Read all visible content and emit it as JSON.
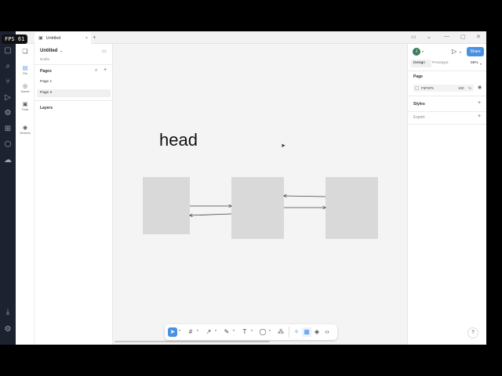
{
  "overlay": {
    "fps": "FPS 61"
  },
  "browser": {
    "tab_title": "Untitled",
    "tab_close": "×",
    "new_tab": "+"
  },
  "rail": {
    "items": [
      {
        "label": "File",
        "icon": "file-icon"
      },
      {
        "label": "Assets",
        "icon": "assets-icon"
      },
      {
        "label": "Tools",
        "icon": "tools-icon"
      },
      {
        "label": "Versions",
        "icon": "versions-icon"
      }
    ]
  },
  "left_panel": {
    "file_name": "Untitled",
    "location": "Drafts",
    "pages_heading": "Pages",
    "pages": [
      {
        "label": "Page 1",
        "active": false
      },
      {
        "label": "Page 2",
        "active": true
      }
    ],
    "layers_heading": "Layers"
  },
  "canvas": {
    "text_layer": "head"
  },
  "right_panel": {
    "avatar_initial": "J",
    "share_label": "Share",
    "tabs": [
      {
        "label": "Design",
        "active": true
      },
      {
        "label": "Prototype",
        "active": false
      }
    ],
    "zoom": "56%",
    "page_heading": "Page",
    "page_color_hex": "F5F5F5",
    "page_opacity": "100",
    "page_opacity_unit": "%",
    "styles_heading": "Styles",
    "export_heading": "Export",
    "add_glyph": "+"
  },
  "help": {
    "label": "?"
  },
  "colors": {
    "accent": "#4a90e2",
    "canvas_bg": "#f4f4f4",
    "frame_fill": "#d9d9d9"
  }
}
